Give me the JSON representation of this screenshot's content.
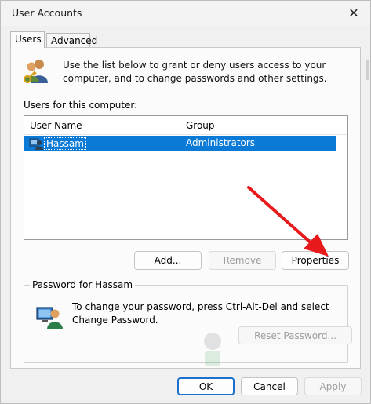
{
  "window": {
    "title": "User Accounts",
    "close_glyph": "✕"
  },
  "tabs": [
    {
      "label": "Users",
      "active": true
    },
    {
      "label": "Advanced",
      "active": false
    }
  ],
  "intro": {
    "icon": "users-keys-icon",
    "text": "Use the list below to grant or deny users access to your computer, and to change passwords and other settings."
  },
  "users_list": {
    "label": "Users for this computer:",
    "columns": [
      "User Name",
      "Group"
    ],
    "rows": [
      {
        "name": "Hassam",
        "group": "Administrators",
        "selected": true
      }
    ]
  },
  "buttons": {
    "add": "Add...",
    "remove": "Remove",
    "properties": "Properties"
  },
  "password_group": {
    "title": "Password for Hassam",
    "text": "To change your password, press Ctrl-Alt-Del and select Change Password.",
    "reset_button": "Reset Password..."
  },
  "footer": {
    "ok": "OK",
    "cancel": "Cancel",
    "apply": "Apply"
  },
  "colors": {
    "selection": "#0a7ad6",
    "arrow": "#e8191b",
    "accent": "#1a6fd0"
  }
}
